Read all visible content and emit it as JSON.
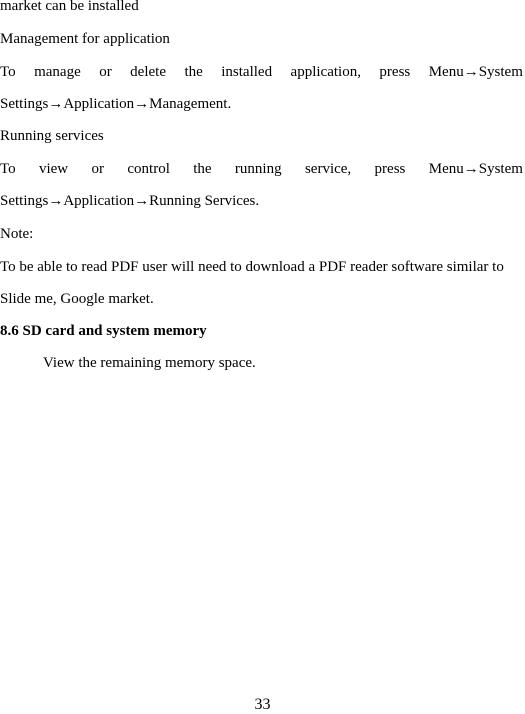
{
  "document": {
    "lines": {
      "l1": "market can be installed",
      "l2": "Management for application",
      "l3_words": [
        "To",
        "manage",
        "or",
        "delete",
        "the",
        "installed",
        "application,",
        "press",
        "Menu→System"
      ],
      "l4": "Settings→Application→Management.",
      "l5": "Running services",
      "l6_words": [
        "To",
        "view",
        "or",
        "control",
        "the",
        "running",
        "service,",
        "press",
        "Menu→System"
      ],
      "l7": "Settings→Application→Running Services.",
      "l8": "Note:",
      "l9": "To be able to read PDF user will need to download a PDF reader software similar to",
      "l10": "Slide me, Google market.",
      "heading": "8.6 SD card and system memory",
      "l11": "View the remaining memory space."
    },
    "page_number": "33"
  }
}
